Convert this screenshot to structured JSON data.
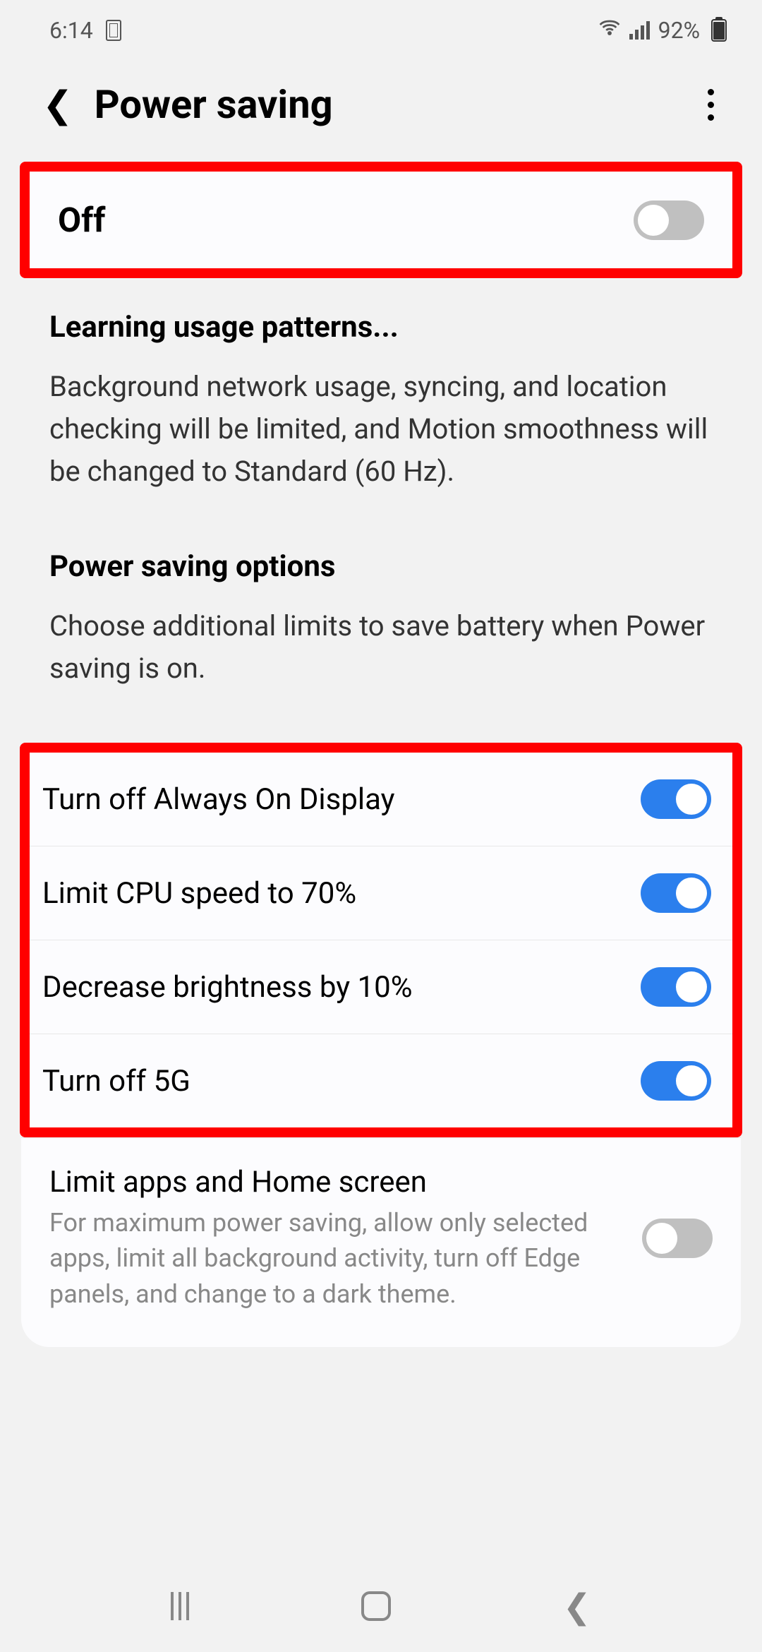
{
  "status": {
    "time": "6:14",
    "battery_pct": "92%"
  },
  "header": {
    "title": "Power saving"
  },
  "master_toggle": {
    "label": "Off",
    "state": "off"
  },
  "info": {
    "learning_header": "Learning usage patterns...",
    "learning_body": "Background network usage, syncing, and location checking will be limited, and Motion smoothness will be changed to Standard (60 Hz).",
    "options_header": "Power saving options",
    "options_body": "Choose additional limits to save battery when Power saving is on."
  },
  "options": [
    {
      "label": "Turn off Always On Display",
      "state": "on"
    },
    {
      "label": "Limit CPU speed to 70%",
      "state": "on"
    },
    {
      "label": "Decrease brightness by 10%",
      "state": "on"
    },
    {
      "label": "Turn off 5G",
      "state": "on"
    }
  ],
  "limit_apps": {
    "title": "Limit apps and Home screen",
    "desc": "For maximum power saving, allow only selected apps, limit all background activity, turn off Edge panels, and change to a dark theme.",
    "state": "off"
  }
}
